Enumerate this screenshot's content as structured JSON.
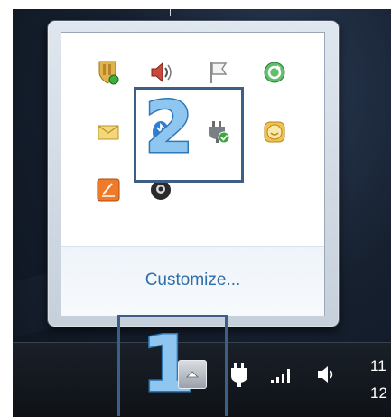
{
  "popup": {
    "customize_label": "Customize...",
    "icons": [
      "security-shield-icon",
      "volume-icon",
      "action-center-flag-icon",
      "sync-icon",
      "mail-icon",
      "bluetooth-icon",
      "power-plug-icon",
      "smiley-icon",
      "pen-tablet-icon",
      "webcam-icon"
    ]
  },
  "callouts": {
    "one": "1",
    "two": "2"
  },
  "taskbar": {
    "show_hidden_icon": "chevron-up-icon",
    "clock_line1": "11",
    "clock_line2": "12"
  },
  "colors": {
    "callout_border": "#3d5e86",
    "callout_fill": "#8fc6f0",
    "link": "#2f6ea8"
  }
}
